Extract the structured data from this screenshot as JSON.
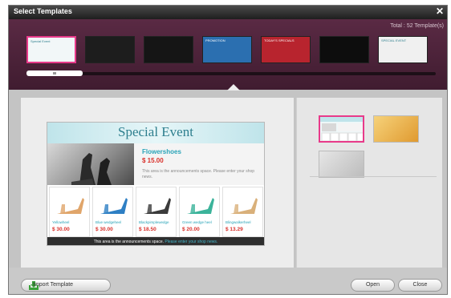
{
  "window": {
    "title": "Select Templates",
    "close_glyph": "✕"
  },
  "strip": {
    "total": "Total : 52 Template(s)",
    "thumbnails": [
      {
        "id": "special-event-shoes",
        "bg": "#f2f7f8",
        "selected": true,
        "mini_title": "Special Event"
      },
      {
        "id": "dark-people",
        "bg": "#1d1d1d",
        "selected": false,
        "mini_title": ""
      },
      {
        "id": "black-plain",
        "bg": "#151515",
        "selected": false,
        "mini_title": ""
      },
      {
        "id": "blue-promotion",
        "bg": "#2b6fb0",
        "selected": false,
        "mini_title": "PROMOTION"
      },
      {
        "id": "red-specials",
        "bg": "#b8242e",
        "selected": false,
        "mini_title": "TODAY'S SPECIALS"
      },
      {
        "id": "green-black",
        "bg": "#0d0d0d",
        "selected": false,
        "mini_title": ""
      },
      {
        "id": "special-event-gray",
        "bg": "#f0f0f0",
        "selected": false,
        "mini_title": "SPECIAL EVENT"
      }
    ]
  },
  "preview": {
    "title": "Special Event",
    "product_name": "Flowershoes",
    "product_price": "$ 15.00",
    "description": "This area is the announcements space. Please enter your shop news.",
    "products": [
      {
        "name": "Yellowheel",
        "price": "$ 30.00",
        "color": "#e0a56a"
      },
      {
        "name": "Blue wedgeheel",
        "price": "$ 30.00",
        "color": "#2e7fc4"
      },
      {
        "name": "Blackpimplewedge",
        "price": "$ 18.50",
        "color": "#3b3b3b"
      },
      {
        "name": "Green wedge heel",
        "price": "$ 20.00",
        "color": "#3bb39a"
      },
      {
        "name": "Blingwalkerheel",
        "price": "$ 13.29",
        "color": "#d9b07a"
      }
    ],
    "footer_text": "This area is the announcements space.",
    "footer_link": "Please enter your shop news."
  },
  "right_templates": [
    {
      "id": "layout-blank",
      "selected": true,
      "bg": "#eef7f8"
    },
    {
      "id": "orange-abstract",
      "selected": false,
      "bg": "#e8b54c"
    },
    {
      "id": "gray-blur",
      "selected": false,
      "bg": "#d4d4d4"
    }
  ],
  "buttons": {
    "import": "Import Template",
    "open": "Open",
    "close": "Close"
  },
  "colors": {
    "accent_pink": "#e83a8a",
    "strip_purple": "#4e2439",
    "price_red": "#d9302a",
    "title_teal": "#2e7f8e"
  }
}
